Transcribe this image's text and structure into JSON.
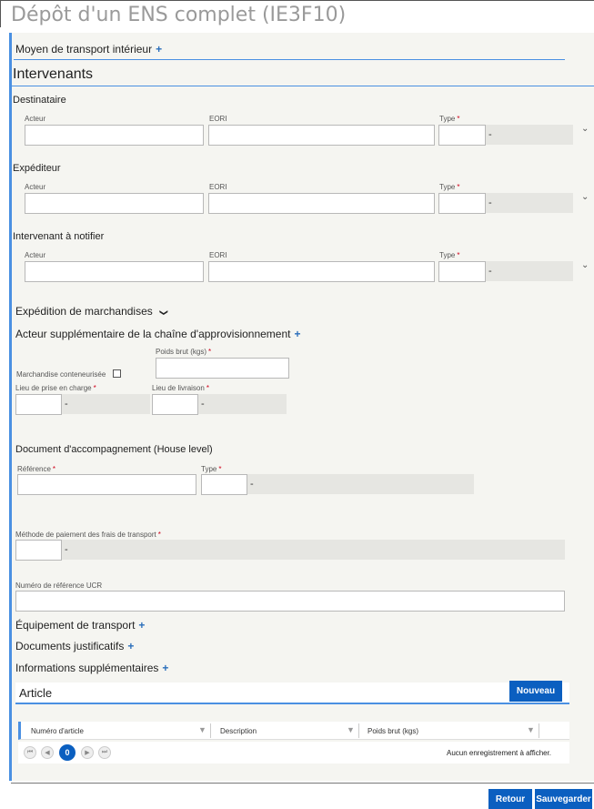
{
  "page": {
    "title": "Dépôt d'un ENS complet (IE3F10)"
  },
  "transport_interieur": {
    "label": "Moyen de transport intérieur",
    "plus": "+"
  },
  "intervenants": {
    "title": "Intervenants",
    "labels": {
      "acteur": "Acteur",
      "eori": "EORI",
      "type": "Type",
      "req": "*",
      "dash": "-",
      "chevron": "⌄"
    },
    "groups": [
      {
        "title": "Destinataire"
      },
      {
        "title": "Expéditeur"
      },
      {
        "title": "Intervenant à notifier"
      }
    ]
  },
  "expedition": {
    "title": "Expédition de marchandises",
    "toggle": "❯",
    "acteur_supp": "Acteur supplémentaire de la chaîne d'approvisionnement",
    "plus": "+",
    "poids_brut": "Poids brut (kgs)",
    "conteneurisee": "Marchandise conteneurisée",
    "lieu_prise": "Lieu de prise en charge",
    "lieu_livraison": "Lieu de livraison",
    "req": "*",
    "dash": "-"
  },
  "document": {
    "title": "Document d'accompagnement (House level)",
    "reference": "Référence",
    "type": "Type",
    "req": "*",
    "dash": "-"
  },
  "paiement": {
    "label": "Méthode de paiement des frais de transport",
    "req": "*",
    "dash": "-"
  },
  "ucr": {
    "label": "Numéro de référence UCR"
  },
  "sections": [
    {
      "label": "Équipement de transport",
      "plus": "+"
    },
    {
      "label": "Documents justificatifs",
      "plus": "+"
    },
    {
      "label": "Informations supplémentaires",
      "plus": "+"
    }
  ],
  "article": {
    "title": "Article",
    "new_button": "Nouveau",
    "columns": [
      "Numéro d'article",
      "Description",
      "Poids brut (kgs)"
    ],
    "filter_icon": "▼",
    "pager": {
      "first": "⏮",
      "prev": "◀",
      "current": "0",
      "next": "▶",
      "last": "⏭"
    },
    "empty_text": "Aucun enregistrement à afficher."
  },
  "footer": {
    "back": "Retour",
    "save": "Sauvegarder"
  }
}
